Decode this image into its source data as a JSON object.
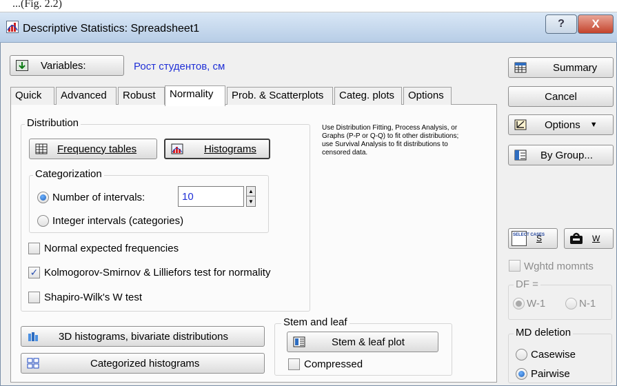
{
  "caption_fragment": "...(Fig. 2.2)",
  "window": {
    "title": "Descriptive Statistics: Spreadsheet1",
    "help_glyph": "?",
    "close_glyph": "X"
  },
  "variables": {
    "button_label": "Variables:",
    "value": "Рост студентов, см"
  },
  "tabs": [
    {
      "label": "Quick"
    },
    {
      "label": "Advanced"
    },
    {
      "label": "Robust"
    },
    {
      "label": "Normality"
    },
    {
      "label": "Prob. & Scatterplots"
    },
    {
      "label": "Categ. plots"
    },
    {
      "label": "Options"
    }
  ],
  "active_tab": "Normality",
  "distribution": {
    "group_label": "Distribution",
    "frequency_tables_label": "Frequency tables",
    "histograms_label": "Histograms"
  },
  "hint_text": "Use Distribution Fitting, Process Analysis, or Graphs (P-P or Q-Q) to fit other distributions; use Survival Analysis to fit distributions to censored data.",
  "categorization": {
    "group_label": "Categorization",
    "number_of_intervals_label": "Number of intervals:",
    "number_of_intervals_value": "10",
    "number_of_intervals_selected": true,
    "integer_intervals_label": "Integer intervals (categories)",
    "integer_intervals_selected": false
  },
  "options": {
    "normal_expected_label": "Normal expected frequencies",
    "normal_expected_checked": false,
    "ks_label": "Kolmogorov-Smirnov & Lilliefors test for normality",
    "ks_checked": true,
    "sw_label": "Shapiro-Wilk's W test",
    "sw_checked": false,
    "check_glyph": "✓"
  },
  "bottom_buttons": {
    "hist3d_label": "3D histograms, bivariate distributions",
    "categorized_label": "Categorized histograms"
  },
  "stem_leaf": {
    "group_label": "Stem and leaf",
    "plot_label": "Stem & leaf plot",
    "compressed_label": "Compressed",
    "compressed_checked": false
  },
  "right_panel": {
    "summary_label": "Summary",
    "cancel_label": "Cancel",
    "options_label": "Options",
    "options_arrow": "▼",
    "by_group_label": "By Group...",
    "select_cases_icon_text": "SELECT CASES",
    "s_label": "S",
    "w_label": "W",
    "weighted_moments_label": "Wghtd momnts",
    "weighted_moments_checked": false,
    "df_label": "DF =",
    "df_w1_label": "W-1",
    "df_n1_label": "N-1",
    "df_selected": "W-1",
    "md_deletion_label": "MD deletion",
    "casewise_label": "Casewise",
    "pairwise_label": "Pairwise",
    "md_selected": "Pairwise"
  },
  "colors": {
    "title_gradient_top": "#d9e7f6",
    "close_button": "#c4432c",
    "variable_text": "#1f2fd6",
    "hint_text": "#000000"
  }
}
